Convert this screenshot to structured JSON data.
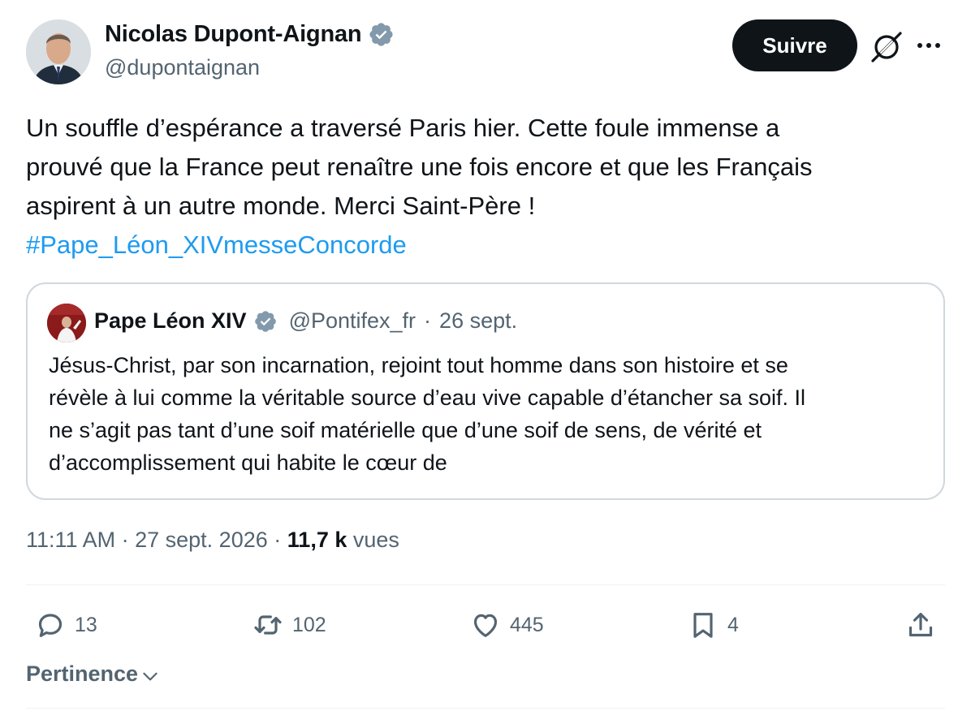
{
  "author": {
    "display_name": "Nicolas Dupont-Aignan",
    "handle": "@dupontaignan",
    "verified": true
  },
  "header": {
    "follow_label": "Suivre",
    "grok_icon": "grok-icon",
    "more_icon": "more-icon"
  },
  "tweet": {
    "lines": [
      "Un souffle d’espérance a traversé Paris hier. Cette foule immense a",
      "prouvé que la France peut renaître une fois encore et que les Français",
      "aspirent à un autre monde. Merci Saint-Père !"
    ],
    "hashtag": "#Pape_Léon_XIVmesseConcorde"
  },
  "quote": {
    "display_name": "Pape Léon XIV",
    "handle": "@Pontifex_fr",
    "separator": "·",
    "date": "26 sept.",
    "lines": [
      "Jésus-Christ, par son incarnation, rejoint tout homme dans son histoire et se",
      "révèle à lui comme la véritable source d’eau vive capable d’étancher sa soif. Il",
      "ne s’agit pas tant d’une soif matérielle que d’une soif de sens, de vérité et",
      "d’accomplissement qui habite le cœur de"
    ]
  },
  "meta": {
    "time": "11:11 AM",
    "separator": "·",
    "date": "27 sept. 2026",
    "views_count": "11,7 k",
    "views_label": "vues"
  },
  "actions": {
    "replies": "13",
    "reposts": "102",
    "likes": "445",
    "bookmarks": "4"
  },
  "sort": {
    "label": "Pertinence"
  },
  "colors": {
    "text_primary": "#0f1419",
    "text_secondary": "#536471",
    "link": "#1d9bf0",
    "verified": "#829aab",
    "border": "#cfd9de",
    "divider": "#eff3f4"
  }
}
